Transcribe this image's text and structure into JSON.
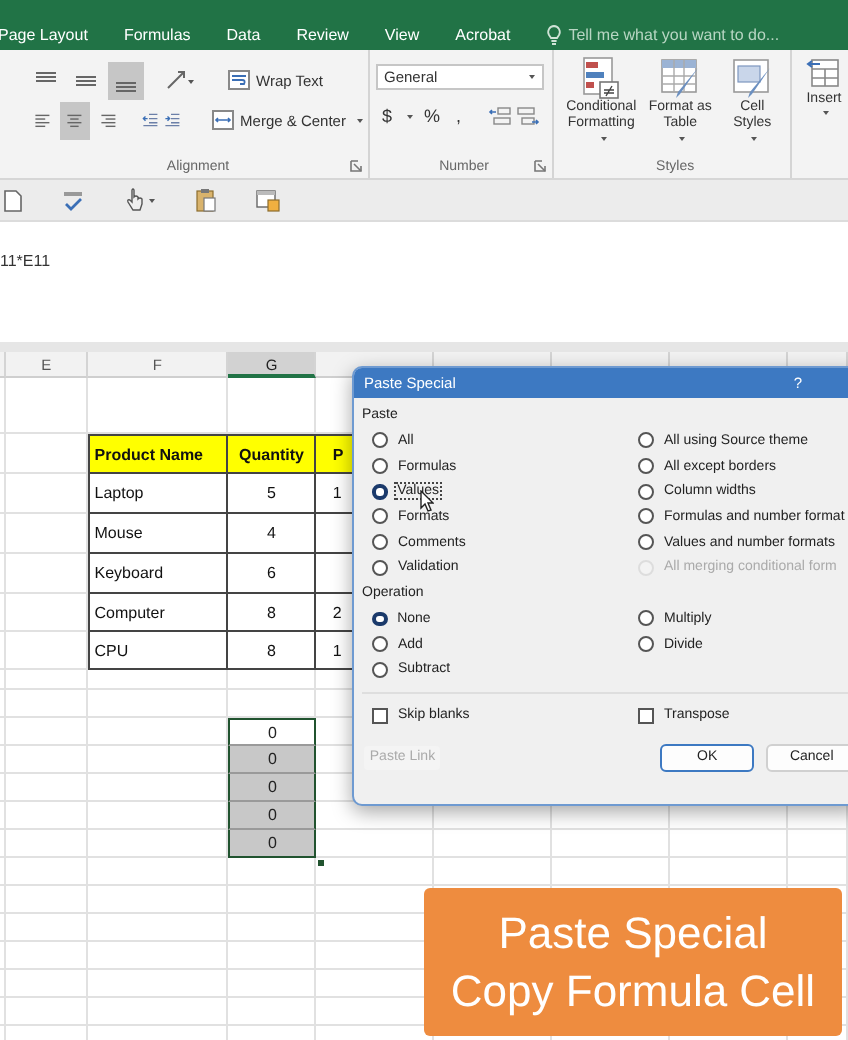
{
  "ribbon_tabs": [
    {
      "label": "Page Layout",
      "selected": false
    },
    {
      "label": "Formulas",
      "selected": false
    },
    {
      "label": "Data",
      "selected": false
    },
    {
      "label": "Review",
      "selected": false
    },
    {
      "label": "View",
      "selected": false
    },
    {
      "label": "Acrobat",
      "selected": false
    }
  ],
  "tell_me": {
    "placeholder": "Tell me what you want to do..."
  },
  "ribbon_groups": [
    {
      "kind": "alignment",
      "label": "Alignment",
      "buttons": [
        "Wrap Text",
        "Merge & Center"
      ],
      "align_buttons": [
        {
          "kind": "top",
          "on": false
        },
        {
          "kind": "middle",
          "on": false
        },
        {
          "kind": "bottom",
          "on": true
        },
        {
          "kind": "left",
          "on": false
        },
        {
          "kind": "center",
          "on": true
        },
        {
          "kind": "right",
          "on": false
        }
      ]
    },
    {
      "kind": "number",
      "label": "Number",
      "format": "General",
      "symbols": [
        "$",
        "%",
        ","
      ]
    },
    {
      "kind": "styles",
      "label": "Styles",
      "buttons": [
        "Conditional Formatting",
        "Format as Table",
        "Cell Styles"
      ]
    },
    {
      "kind": "cells",
      "buttons": [
        "Insert"
      ]
    }
  ],
  "formula_bar": {
    "value": "11*E11"
  },
  "columns": [
    {
      "label": "E",
      "selected": false
    },
    {
      "label": "F",
      "selected": false
    },
    {
      "label": "G",
      "selected": true
    }
  ],
  "table": {
    "header": [
      "Product Name",
      "Quantity",
      "P"
    ],
    "rows": [
      [
        "Laptop",
        "5",
        "1"
      ],
      [
        "Mouse",
        "4"
      ],
      [
        "Keyboard",
        "6"
      ],
      [
        "Computer",
        "8",
        "2"
      ],
      [
        "CPU",
        "8",
        "1"
      ]
    ]
  },
  "pasted_cells": [
    {
      "value": "0",
      "active": true
    },
    {
      "value": "0",
      "active": false
    },
    {
      "value": "0",
      "active": false
    },
    {
      "value": "0",
      "active": false
    },
    {
      "value": "0",
      "active": false
    }
  ],
  "dialog": {
    "title": "Paste Special",
    "help": "?",
    "paste_label": "Paste",
    "paste_options": [
      {
        "label": "All",
        "selected": false,
        "disabled": false,
        "focused": false
      },
      {
        "label": "Formulas",
        "selected": false,
        "disabled": false,
        "focused": false
      },
      {
        "label": "Values",
        "selected": true,
        "disabled": false,
        "focused": true
      },
      {
        "label": "Formats",
        "selected": false,
        "disabled": false,
        "focused": false
      },
      {
        "label": "Comments",
        "selected": false,
        "disabled": false,
        "focused": false
      },
      {
        "label": "Validation",
        "selected": false,
        "disabled": false,
        "focused": false
      },
      {
        "label": "All using Source theme",
        "selected": false,
        "disabled": false,
        "focused": false
      },
      {
        "label": "All except borders",
        "selected": false,
        "disabled": false,
        "focused": false
      },
      {
        "label": "Column widths",
        "selected": false,
        "disabled": false,
        "focused": false
      },
      {
        "label": "Formulas and number format",
        "selected": false,
        "disabled": false,
        "focused": false
      },
      {
        "label": "Values and number formats",
        "selected": false,
        "disabled": false,
        "focused": false
      },
      {
        "label": "All merging conditional form",
        "selected": false,
        "disabled": true,
        "focused": false
      }
    ],
    "operation_label": "Operation",
    "operation_options": [
      {
        "label": "None",
        "selected": true
      },
      {
        "label": "Add",
        "selected": false
      },
      {
        "label": "Subtract",
        "selected": false
      },
      {
        "label": "Multiply",
        "selected": false
      },
      {
        "label": "Divide",
        "selected": false
      }
    ],
    "checkboxes": [
      {
        "label": "Skip blanks",
        "checked": false
      },
      {
        "label": "Transpose",
        "checked": false
      }
    ],
    "buttons": [
      {
        "label": "Paste Link",
        "disabled": true,
        "default": false
      },
      {
        "label": "OK",
        "disabled": false,
        "default": true
      },
      {
        "label": "Cancel",
        "disabled": false,
        "default": false
      }
    ]
  },
  "caption": {
    "lines": [
      "Paste Special",
      "Copy Formula Cell"
    ]
  }
}
